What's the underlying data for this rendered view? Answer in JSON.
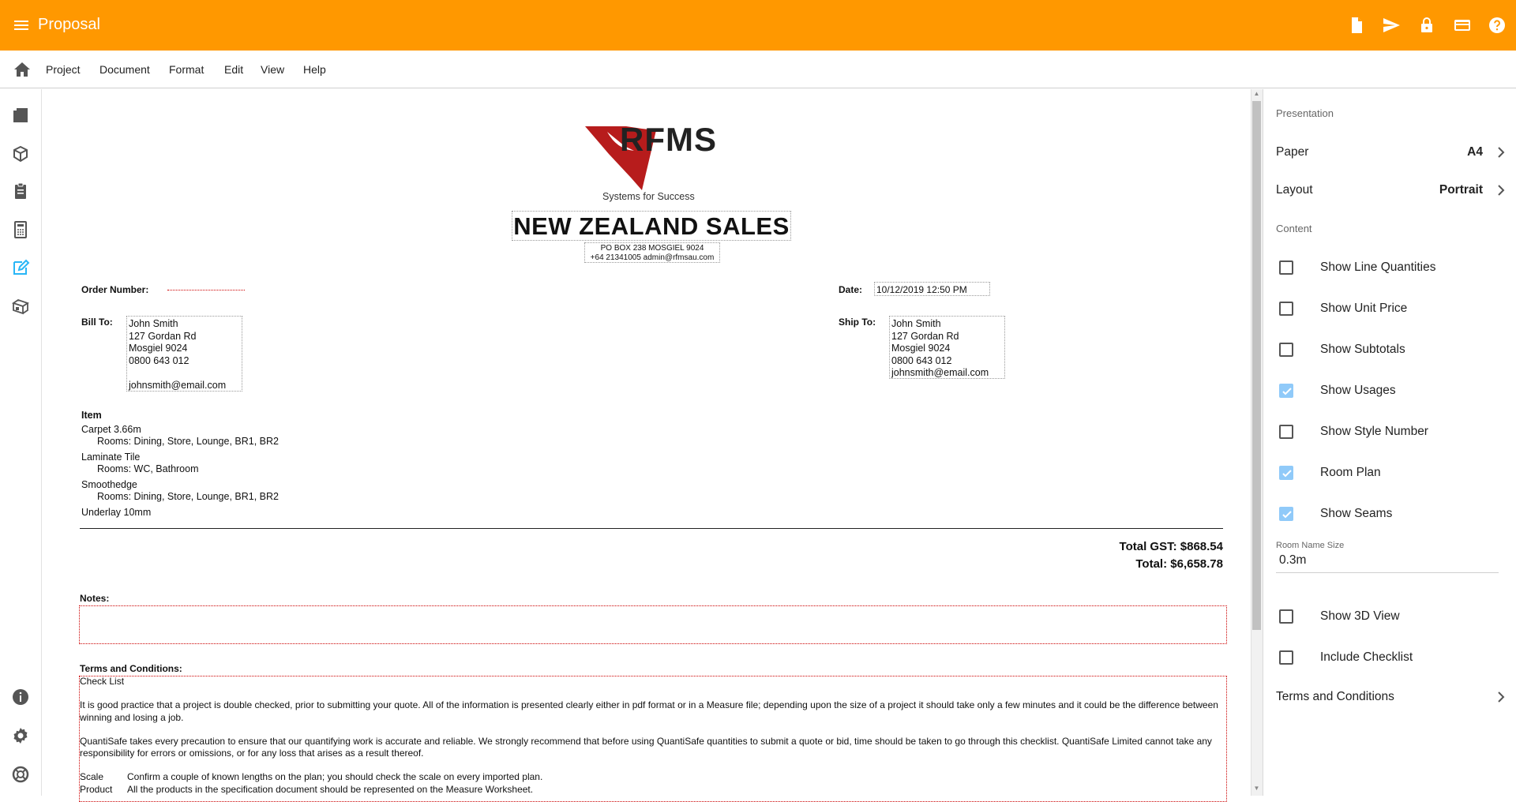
{
  "app": {
    "title": "Proposal",
    "accent": "#FF9800"
  },
  "topbar_icons": [
    "document-icon",
    "send-icon",
    "lock-icon",
    "credit-card-icon",
    "help-icon"
  ],
  "menu": {
    "items": [
      "Project",
      "Document",
      "Format",
      "Edit",
      "View",
      "Help"
    ]
  },
  "leftrail_icons": [
    "layers-icon",
    "box-icon",
    "clipboard-icon",
    "calculator-icon",
    "edit-document-icon",
    "package-icon",
    "info-icon",
    "settings-icon",
    "support-icon"
  ],
  "document": {
    "logo_text": "RFMS",
    "logo_tagline": "Systems for Success",
    "company": "NEW ZEALAND SALES",
    "address_line1": "PO BOX 238 MOSGIEL  9024",
    "address_line2": "+64 21341005  admin@rfmsau.com",
    "order_number_label": "Order Number:",
    "date_label": "Date:",
    "date_value": "10/12/2019 12:50 PM",
    "bill_to_label": "Bill To:",
    "ship_to_label": "Ship To:",
    "bill_to": [
      "John Smith",
      "127 Gordan Rd",
      "Mosgiel  9024",
      "0800 643 012",
      "",
      "johnsmith@email.com"
    ],
    "ship_to": [
      "John Smith",
      "127 Gordan Rd",
      "Mosgiel  9024",
      "0800 643 012",
      "johnsmith@email.com"
    ],
    "item_header": "Item",
    "items": [
      {
        "name": "Carpet 3.66m",
        "rooms": "Rooms: Dining, Store, Lounge, BR1, BR2"
      },
      {
        "name": "Laminate Tile",
        "rooms": "Rooms: WC, Bathroom"
      },
      {
        "name": "Smoothedge",
        "rooms": "Rooms: Dining, Store, Lounge, BR1, BR2"
      },
      {
        "name": "Underlay 10mm",
        "rooms": ""
      }
    ],
    "total_gst": "Total GST: $868.54",
    "total": "Total: $6,658.78",
    "notes_label": "Notes:",
    "terms_label": "Terms and Conditions:",
    "terms": {
      "title": "Check List",
      "para1": "It is good practice that a project is double checked, prior to submitting your quote. All of the information is presented clearly either in pdf format or in a Measure file; depending upon the size of a project it should take only a few minutes and it could be the difference between winning and losing a job.",
      "para2": "QuantiSafe takes every precaution to ensure that our quantifying work is accurate and reliable. We strongly recommend that before using QuantiSafe quantities to submit a quote or bid, time should be taken to go through this checklist. QuantiSafe Limited cannot take any responsibility for errors or omissions, or for any loss that arises as a result thereof.",
      "rows": [
        {
          "k": "Scale",
          "v": "Confirm a couple of known lengths on the plan; you should check the scale on every imported plan."
        },
        {
          "k": "Product",
          "v": "All the products in the specification document should be represented on the Measure Worksheet."
        }
      ]
    }
  },
  "panel": {
    "presentation_label": "Presentation",
    "paper_label": "Paper",
    "paper_value": "A4",
    "layout_label": "Layout",
    "layout_value": "Portrait",
    "content_label": "Content",
    "checkboxes": [
      {
        "label": "Show Line Quantities",
        "checked": false
      },
      {
        "label": "Show Unit Price",
        "checked": false
      },
      {
        "label": "Show Subtotals",
        "checked": false
      },
      {
        "label": "Show Usages",
        "checked": true
      },
      {
        "label": "Show Style Number",
        "checked": false
      },
      {
        "label": "Room Plan",
        "checked": true
      },
      {
        "label": "Show Seams",
        "checked": true
      }
    ],
    "room_name_size_label": "Room Name Size",
    "room_name_size_value": "0.3m",
    "checkboxes2": [
      {
        "label": "Show 3D View",
        "checked": false
      },
      {
        "label": "Include Checklist",
        "checked": false
      }
    ],
    "terms_label": "Terms and Conditions",
    "check_color": "#90CAF9"
  }
}
